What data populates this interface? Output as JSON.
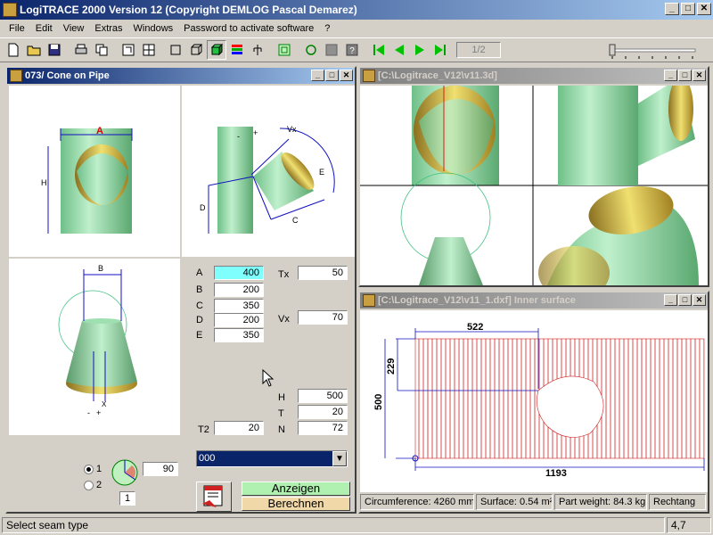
{
  "app": {
    "title": "LogiTRACE 2000  Version 12  (Copyright DEMLOG Pascal Demarez)"
  },
  "menu": [
    "File",
    "Edit",
    "View",
    "Extras",
    "Windows",
    "Password to activate software",
    "?"
  ],
  "toolbar": {
    "page": "1/2"
  },
  "win_left": {
    "title": "073/ Cone on Pipe",
    "params_left": [
      {
        "label": "A",
        "value": "400"
      },
      {
        "label": "B",
        "value": "200"
      },
      {
        "label": "C",
        "value": "350"
      },
      {
        "label": "D",
        "value": "200"
      },
      {
        "label": "E",
        "value": "350"
      }
    ],
    "tx": {
      "label": "Tx",
      "value": "50"
    },
    "vx": {
      "label": "Vx",
      "value": "70"
    },
    "params_right": [
      {
        "label": "H",
        "value": "500"
      },
      {
        "label": "T",
        "value": "20"
      },
      {
        "label": "N",
        "value": "72"
      }
    ],
    "t2": {
      "label": "T2",
      "value": "20"
    },
    "dropdown": "000",
    "radio1": "1",
    "radio2": "2",
    "angle": "90",
    "seam": "1",
    "btn_anzeigen": "Anzeigen",
    "btn_berechnen": "Berechnen",
    "diagram": {
      "a": "A",
      "h": "H",
      "b": "B",
      "d": "D",
      "e": "E",
      "c": "C",
      "vx": "Vx",
      "minus": "-",
      "plus": "+",
      "x": "X"
    }
  },
  "win_3d": {
    "title": "[C:\\Logitrace_V12\\v11.3d]"
  },
  "win_dxf": {
    "title": "[C:\\Logitrace_V12\\v11_1.dxf]  Inner surface",
    "dim_522": "522",
    "dim_229": "229",
    "dim_500": "500",
    "dim_1193": "1193",
    "circumference": "Circumference: 4260 mm",
    "surface": "Surface: 0.54 m²",
    "weight": "Part weight: 84.3 kg",
    "shape": "Rechtang"
  },
  "status": {
    "message": "Select seam type",
    "coord": "4,7"
  },
  "colors": {
    "accent": "#0a246a",
    "pipe": "#8fd9a8",
    "stripe": "#d02020"
  }
}
